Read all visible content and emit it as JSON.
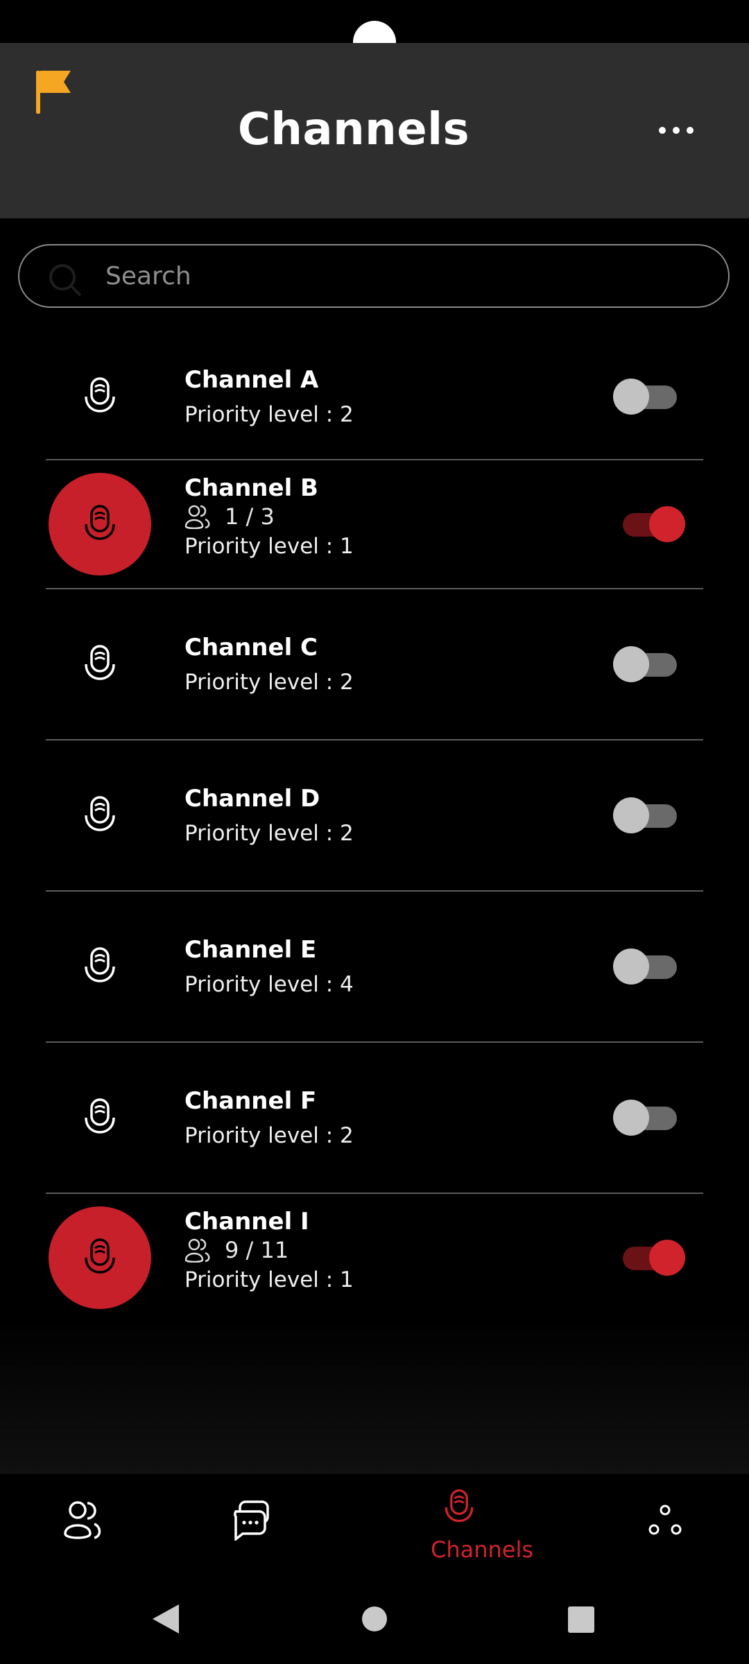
{
  "header": {
    "title": "Channels"
  },
  "search": {
    "placeholder": "Search"
  },
  "channels": [
    {
      "name": "Channel A",
      "priority": "Priority level : 2",
      "users": null,
      "active": false
    },
    {
      "name": "Channel B",
      "priority": "Priority level : 1",
      "users": "1 / 3",
      "active": true
    },
    {
      "name": "Channel C",
      "priority": "Priority level : 2",
      "users": null,
      "active": false
    },
    {
      "name": "Channel D",
      "priority": "Priority level : 2",
      "users": null,
      "active": false
    },
    {
      "name": "Channel E",
      "priority": "Priority level : 4",
      "users": null,
      "active": false
    },
    {
      "name": "Channel F",
      "priority": "Priority level : 2",
      "users": null,
      "active": false
    },
    {
      "name": "Channel I",
      "priority": "Priority level : 1",
      "users": "9 / 11",
      "active": true
    }
  ],
  "nav": {
    "items": [
      {
        "icon": "contacts-icon",
        "label": ""
      },
      {
        "icon": "chat-icon",
        "label": ""
      },
      {
        "icon": "mic-icon",
        "label": "Channels",
        "selected": true
      },
      {
        "icon": "more-apps-icon",
        "label": ""
      }
    ]
  },
  "colors": {
    "accent": "#d1232c",
    "appbar": "#2e2e2e",
    "flag": "#f5a623"
  }
}
